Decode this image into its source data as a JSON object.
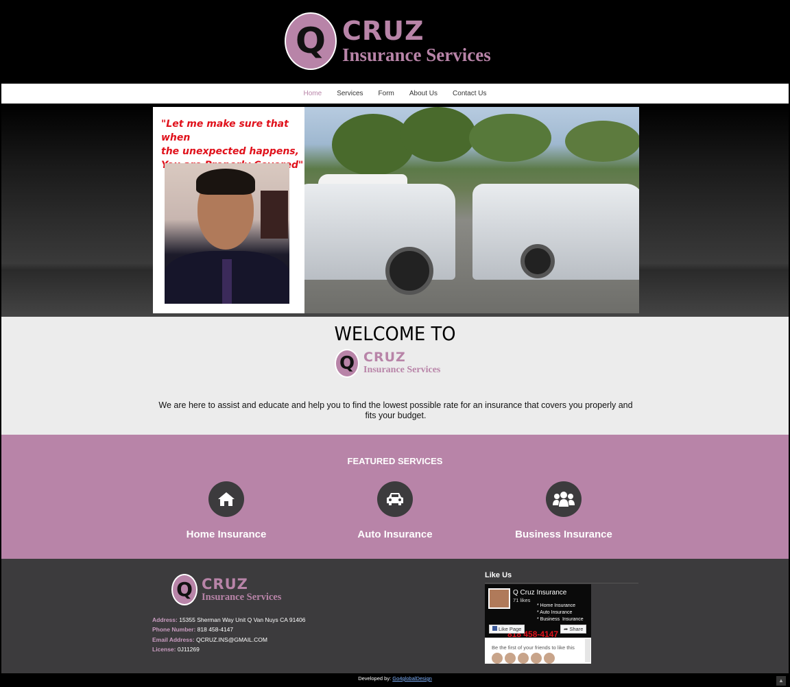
{
  "brand": {
    "q": "Q",
    "name": "CRUZ",
    "subtitle": "Insurance Services",
    "accent_color": "#b884a8"
  },
  "nav": {
    "items": [
      "Home",
      "Services",
      "Form",
      "About Us",
      "Contact Us"
    ],
    "active": "Home"
  },
  "banner": {
    "quote_lines": [
      "\"Let me make sure that when",
      "the unexpected happens,",
      "You are Properly Covered\""
    ]
  },
  "welcome": {
    "title": "WELCOME TO",
    "text": "We are here to assist and educate and help you to find the lowest possible rate for an insurance that covers you properly and fits your budget."
  },
  "services": {
    "title": "FEATURED SERVICES",
    "items": [
      {
        "label": "Home Insurance",
        "icon": "home-icon"
      },
      {
        "label": "Auto Insurance",
        "icon": "car-icon"
      },
      {
        "label": "Business Insurance",
        "icon": "group-icon"
      }
    ]
  },
  "footer": {
    "address_label": "Address:",
    "address": "15355 Sherman Way Unit Q Van Nuys CA 91406",
    "phone_label": "Phone Number:",
    "phone": "818 458-4147",
    "email_label": "Email Address:",
    "email": "QCRUZ.INS@GMAIL.COM",
    "license_label": "License:",
    "license": "0J11269",
    "like_title": "Like Us",
    "fb": {
      "page_name": "Q Cruz Insurance",
      "likes": "71 likes",
      "list": "* Home Insurance\n* Auto Insurance\n* Business  Insurance",
      "phone": "818 458-4147",
      "like_button": "Like Page",
      "share_button": "Share",
      "friends_text": "Be the first of your friends to like this"
    }
  },
  "bottom": {
    "prefix": "Developed by:",
    "link": "Go4globalDesign"
  }
}
